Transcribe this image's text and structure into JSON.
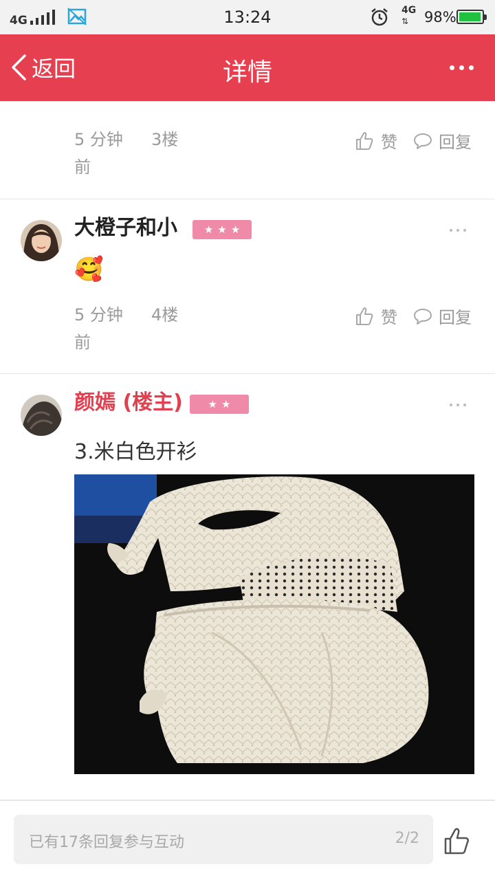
{
  "status_bar": {
    "network": "4G",
    "time": "13:24",
    "data_network": "4G",
    "battery": "98%",
    "battery_level": 0.98,
    "battery_color": "#20c040"
  },
  "header": {
    "back_label": "返回",
    "title": "详情",
    "background": "#e63f50"
  },
  "posts": [
    {
      "time": "5 分钟前",
      "floor": "3楼",
      "like_label": "赞",
      "reply_label": "回复"
    },
    {
      "author": "大橙子和小",
      "level_stars": 3,
      "emoji": "🥰",
      "time": "5 分钟前",
      "floor": "4楼",
      "like_label": "赞",
      "reply_label": "回复"
    },
    {
      "author": "颜嫣 (楼主)",
      "level_stars": 2,
      "text": "3.米白色开衫",
      "image_subject": "cream-knit-cardigan-photo"
    }
  ],
  "bottom_bar": {
    "placeholder": "已有17条回复参与互动",
    "page": "2/2"
  },
  "icons": [
    "back-chevron-icon",
    "more-icon",
    "thumbs-up-icon",
    "speech-bubble-icon",
    "alarm-icon",
    "image-icon"
  ]
}
